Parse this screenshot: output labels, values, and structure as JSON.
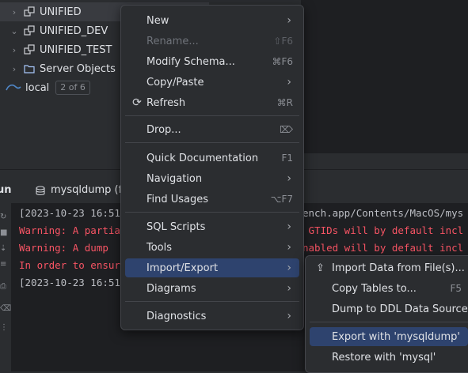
{
  "tree": {
    "items": [
      {
        "label": "UNIFIED",
        "expanded": false
      },
      {
        "label": "UNIFIED_DEV",
        "expanded": true
      },
      {
        "label": "UNIFIED_TEST",
        "expanded": false
      },
      {
        "label": "Server Objects",
        "expanded": false
      }
    ],
    "local": {
      "label": "local",
      "pager": "2 of 6"
    }
  },
  "run_panel": {
    "tab_run": "un",
    "tab_mysqldump": "mysqldump (fi"
  },
  "console": {
    "lines": [
      {
        "text": "[2023-10-23 16:51",
        "type": "normal"
      },
      {
        "text": "Warning: A partia",
        "type": "error"
      },
      {
        "text": "Warning: A dump",
        "type": "error"
      },
      {
        "text": "In order to ensur",
        "type": "error"
      },
      {
        "text": "[2023-10-23 16:51",
        "type": "normal"
      }
    ],
    "right_fragments": [
      {
        "text": "ench.app/Contents/MacOS/mys",
        "type": "normal"
      },
      {
        "text": " GTIDs will by default incl",
        "type": "error"
      },
      {
        "text": "nabled will by default incl",
        "type": "error"
      }
    ]
  },
  "context_menu": {
    "new": {
      "label": "New"
    },
    "rename": {
      "label": "Rename...",
      "shortcut": "⇧F6"
    },
    "modify_schema": {
      "label": "Modify Schema...",
      "shortcut": "⌘F6"
    },
    "copy_paste": {
      "label": "Copy/Paste"
    },
    "refresh": {
      "label": "Refresh",
      "shortcut": "⌘R",
      "icon": "refresh-icon"
    },
    "drop": {
      "label": "Drop...",
      "shortcut": "⌦",
      "icon": "delete-key-icon"
    },
    "quick_doc": {
      "label": "Quick Documentation",
      "shortcut": "F1"
    },
    "navigation": {
      "label": "Navigation"
    },
    "find_usages": {
      "label": "Find Usages",
      "shortcut": "⌥F7"
    },
    "sql_scripts": {
      "label": "SQL Scripts"
    },
    "tools": {
      "label": "Tools"
    },
    "import_export": {
      "label": "Import/Export"
    },
    "diagrams": {
      "label": "Diagrams"
    },
    "diagnostics": {
      "label": "Diagnostics"
    }
  },
  "submenu": {
    "import_file": {
      "label": "Import Data from File(s)...",
      "icon": "import-icon"
    },
    "copy_tables": {
      "label": "Copy Tables to...",
      "shortcut": "F5"
    },
    "dump_ddl": {
      "label": "Dump to DDL Data Source"
    },
    "export_mysqldump": {
      "label": "Export with 'mysqldump'"
    },
    "restore_mysql": {
      "label": "Restore with 'mysql'"
    }
  },
  "colors": {
    "menu_highlight": "#2e436e",
    "error_text": "#f75464",
    "background": "#2b2d30",
    "console_bg": "#1e1f22"
  }
}
